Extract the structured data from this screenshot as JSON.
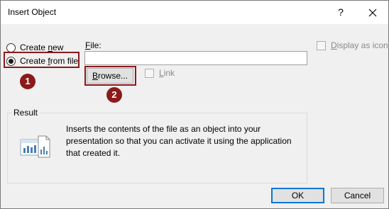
{
  "window": {
    "title": "Insert Object",
    "help_label": "?",
    "close_label": "✕"
  },
  "options": {
    "create_new_prefix": "Create ",
    "create_new_ul": "n",
    "create_new_suffix": "ew",
    "create_from_file_prefix": "Create ",
    "create_from_file_ul": "f",
    "create_from_file_suffix": "rom file",
    "selected": "create_from_file"
  },
  "file": {
    "label_ul": "F",
    "label_rest": "ile:",
    "value": ""
  },
  "browse": {
    "label_ul": "B",
    "label_rest": "rowse..."
  },
  "link": {
    "label_ul": "L",
    "label_rest": "ink",
    "checked": false
  },
  "display_as_icon": {
    "label_ul": "D",
    "label_rest": "isplay as icon",
    "checked": false
  },
  "result": {
    "legend": "Result",
    "text": "Inserts the contents of the file as an object into your presentation so that you can activate it using the application that created it."
  },
  "annotations": {
    "step1": "1",
    "step2": "2",
    "color": "#8b1a1a"
  },
  "buttons": {
    "ok": "OK",
    "cancel": "Cancel"
  }
}
